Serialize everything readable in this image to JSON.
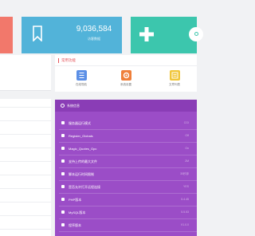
{
  "colors": {
    "card_red": "#f2786b",
    "card_blue": "#52b3d9",
    "card_green": "#3cc6ad",
    "accent_red": "#e5535a",
    "system_purple": "#9b4dc7"
  },
  "stats": {
    "main_card": {
      "icon": "bookmark-icon",
      "value": "9,036,584",
      "label": "访客数据"
    },
    "add_card": {
      "icon": "plus-icon"
    }
  },
  "functions": {
    "title": "常用功能",
    "items": [
      {
        "label": "在线导航",
        "icon": "document-icon",
        "color": "#5b8fe6"
      },
      {
        "label": "系统设置",
        "icon": "gear-icon",
        "color": "#ef7f3a"
      },
      {
        "label": "文章列表",
        "icon": "list-icon",
        "color": "#f0c63a"
      }
    ]
  },
  "system": {
    "title": "系统信息",
    "rows": [
      {
        "icon": "mode-icon",
        "label": "服务器运行模式",
        "value": "CGI"
      },
      {
        "icon": "user-icon",
        "label": "Register_Globals",
        "value": "Off"
      },
      {
        "icon": "quotes-icon",
        "label": "Magic_Quotes_Gpc",
        "value": "On"
      },
      {
        "icon": "upload-icon",
        "label": "支持上传的最大文件",
        "value": "2M"
      },
      {
        "icon": "code-icon",
        "label": "脚本运行时间限制",
        "value": "30秒钟"
      },
      {
        "icon": "link-icon",
        "label": "是否允许打开远程连接",
        "value": "YES"
      },
      {
        "icon": "php-icon",
        "label": "PHP版本",
        "value": "5.4.45"
      },
      {
        "icon": "database-icon",
        "label": "MySQL版本",
        "value": "5.5.53"
      },
      {
        "icon": "program-icon",
        "label": "程序版本",
        "value": "V1.0.0"
      }
    ]
  }
}
